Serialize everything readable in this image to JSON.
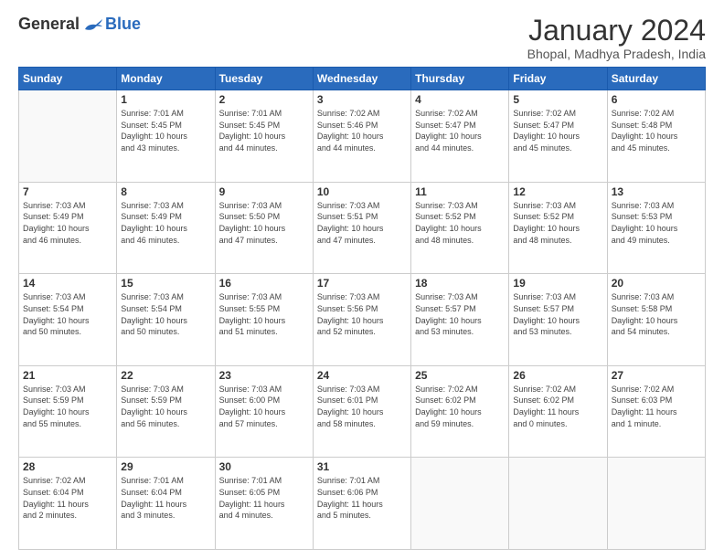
{
  "header": {
    "logo_general": "General",
    "logo_blue": "Blue",
    "title": "January 2024",
    "subtitle": "Bhopal, Madhya Pradesh, India"
  },
  "days_of_week": [
    "Sunday",
    "Monday",
    "Tuesday",
    "Wednesday",
    "Thursday",
    "Friday",
    "Saturday"
  ],
  "weeks": [
    [
      {
        "day": "",
        "info": ""
      },
      {
        "day": "1",
        "info": "Sunrise: 7:01 AM\nSunset: 5:45 PM\nDaylight: 10 hours\nand 43 minutes."
      },
      {
        "day": "2",
        "info": "Sunrise: 7:01 AM\nSunset: 5:45 PM\nDaylight: 10 hours\nand 44 minutes."
      },
      {
        "day": "3",
        "info": "Sunrise: 7:02 AM\nSunset: 5:46 PM\nDaylight: 10 hours\nand 44 minutes."
      },
      {
        "day": "4",
        "info": "Sunrise: 7:02 AM\nSunset: 5:47 PM\nDaylight: 10 hours\nand 44 minutes."
      },
      {
        "day": "5",
        "info": "Sunrise: 7:02 AM\nSunset: 5:47 PM\nDaylight: 10 hours\nand 45 minutes."
      },
      {
        "day": "6",
        "info": "Sunrise: 7:02 AM\nSunset: 5:48 PM\nDaylight: 10 hours\nand 45 minutes."
      }
    ],
    [
      {
        "day": "7",
        "info": "Sunrise: 7:03 AM\nSunset: 5:49 PM\nDaylight: 10 hours\nand 46 minutes."
      },
      {
        "day": "8",
        "info": "Sunrise: 7:03 AM\nSunset: 5:49 PM\nDaylight: 10 hours\nand 46 minutes."
      },
      {
        "day": "9",
        "info": "Sunrise: 7:03 AM\nSunset: 5:50 PM\nDaylight: 10 hours\nand 47 minutes."
      },
      {
        "day": "10",
        "info": "Sunrise: 7:03 AM\nSunset: 5:51 PM\nDaylight: 10 hours\nand 47 minutes."
      },
      {
        "day": "11",
        "info": "Sunrise: 7:03 AM\nSunset: 5:52 PM\nDaylight: 10 hours\nand 48 minutes."
      },
      {
        "day": "12",
        "info": "Sunrise: 7:03 AM\nSunset: 5:52 PM\nDaylight: 10 hours\nand 48 minutes."
      },
      {
        "day": "13",
        "info": "Sunrise: 7:03 AM\nSunset: 5:53 PM\nDaylight: 10 hours\nand 49 minutes."
      }
    ],
    [
      {
        "day": "14",
        "info": "Sunrise: 7:03 AM\nSunset: 5:54 PM\nDaylight: 10 hours\nand 50 minutes."
      },
      {
        "day": "15",
        "info": "Sunrise: 7:03 AM\nSunset: 5:54 PM\nDaylight: 10 hours\nand 50 minutes."
      },
      {
        "day": "16",
        "info": "Sunrise: 7:03 AM\nSunset: 5:55 PM\nDaylight: 10 hours\nand 51 minutes."
      },
      {
        "day": "17",
        "info": "Sunrise: 7:03 AM\nSunset: 5:56 PM\nDaylight: 10 hours\nand 52 minutes."
      },
      {
        "day": "18",
        "info": "Sunrise: 7:03 AM\nSunset: 5:57 PM\nDaylight: 10 hours\nand 53 minutes."
      },
      {
        "day": "19",
        "info": "Sunrise: 7:03 AM\nSunset: 5:57 PM\nDaylight: 10 hours\nand 53 minutes."
      },
      {
        "day": "20",
        "info": "Sunrise: 7:03 AM\nSunset: 5:58 PM\nDaylight: 10 hours\nand 54 minutes."
      }
    ],
    [
      {
        "day": "21",
        "info": "Sunrise: 7:03 AM\nSunset: 5:59 PM\nDaylight: 10 hours\nand 55 minutes."
      },
      {
        "day": "22",
        "info": "Sunrise: 7:03 AM\nSunset: 5:59 PM\nDaylight: 10 hours\nand 56 minutes."
      },
      {
        "day": "23",
        "info": "Sunrise: 7:03 AM\nSunset: 6:00 PM\nDaylight: 10 hours\nand 57 minutes."
      },
      {
        "day": "24",
        "info": "Sunrise: 7:03 AM\nSunset: 6:01 PM\nDaylight: 10 hours\nand 58 minutes."
      },
      {
        "day": "25",
        "info": "Sunrise: 7:02 AM\nSunset: 6:02 PM\nDaylight: 10 hours\nand 59 minutes."
      },
      {
        "day": "26",
        "info": "Sunrise: 7:02 AM\nSunset: 6:02 PM\nDaylight: 11 hours\nand 0 minutes."
      },
      {
        "day": "27",
        "info": "Sunrise: 7:02 AM\nSunset: 6:03 PM\nDaylight: 11 hours\nand 1 minute."
      }
    ],
    [
      {
        "day": "28",
        "info": "Sunrise: 7:02 AM\nSunset: 6:04 PM\nDaylight: 11 hours\nand 2 minutes."
      },
      {
        "day": "29",
        "info": "Sunrise: 7:01 AM\nSunset: 6:04 PM\nDaylight: 11 hours\nand 3 minutes."
      },
      {
        "day": "30",
        "info": "Sunrise: 7:01 AM\nSunset: 6:05 PM\nDaylight: 11 hours\nand 4 minutes."
      },
      {
        "day": "31",
        "info": "Sunrise: 7:01 AM\nSunset: 6:06 PM\nDaylight: 11 hours\nand 5 minutes."
      },
      {
        "day": "",
        "info": ""
      },
      {
        "day": "",
        "info": ""
      },
      {
        "day": "",
        "info": ""
      }
    ]
  ]
}
